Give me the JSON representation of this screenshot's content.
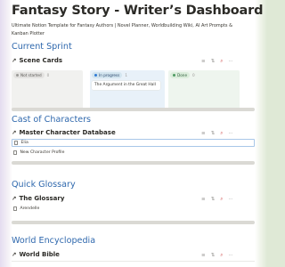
{
  "page": {
    "title": "Fantasy Story - Writer’s Dashboard",
    "subtitle": "Ultimate Notion Template for Fantasy Authors | Novel Planner, Worldbuilding Wiki, AI Art Prompts & Kanban Plotter"
  },
  "sections": {
    "sprint": {
      "heading": "Current Sprint",
      "database": "Scene Cards",
      "columns": [
        {
          "label": "Not started",
          "count": "0",
          "dot": "#9b9a97",
          "bg": "#f1f1ef",
          "tagbg": "#e3e2e0"
        },
        {
          "label": "In progress",
          "count": "1",
          "dot": "#2f7ad6",
          "bg": "#e8f1f9",
          "tagbg": "#d3e5ef",
          "card": "The Argument in the Great Hall"
        },
        {
          "label": "Done",
          "count": "0",
          "dot": "#4e9a62",
          "bg": "#eef5ee",
          "tagbg": "#dbeddb"
        }
      ]
    },
    "cast": {
      "heading": "Cast of Characters",
      "database": "Master Character Database",
      "rows": [
        "Elia",
        "New Character Profile"
      ]
    },
    "glossary": {
      "heading": "Quick Glossary",
      "database": "The Glossary",
      "rows": [
        "Arendelle"
      ]
    },
    "world": {
      "heading": "World Encyclopedia",
      "database": "World Bible"
    }
  },
  "icons": {
    "link": "arrow-up-right-icon",
    "filter": "filter-icon",
    "sort": "sort-icon",
    "search": "search-icon",
    "more": "more-icon",
    "page": "page-icon"
  },
  "colors": {
    "section_heading": "#2f68ad",
    "search_icon": "#d25b5b"
  }
}
